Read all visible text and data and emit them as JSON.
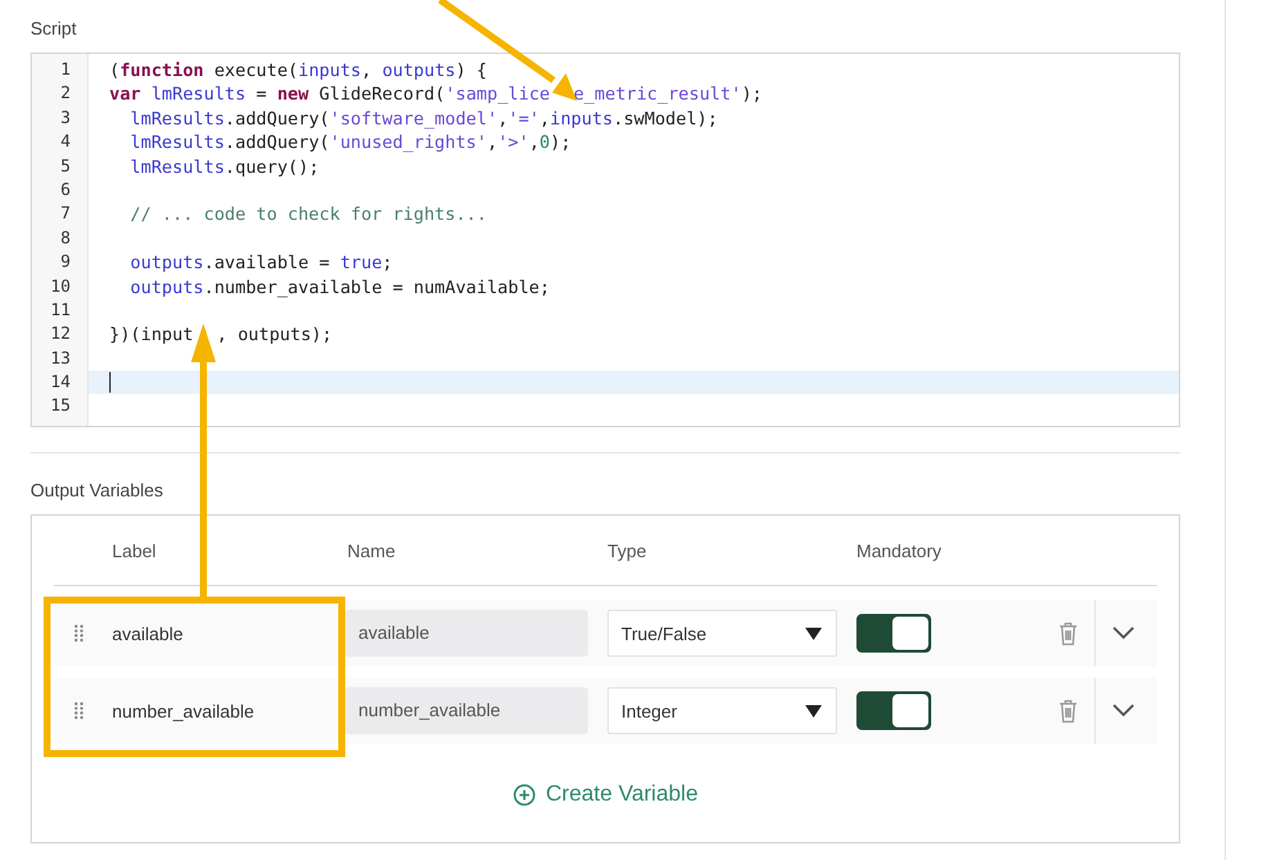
{
  "script": {
    "label": "Script",
    "lines": [
      {
        "number": "1",
        "current": false,
        "tokens": [
          {
            "kind": "plain",
            "text": "("
          },
          {
            "kind": "keyword",
            "text": "function"
          },
          {
            "kind": "plain",
            "text": " execute("
          },
          {
            "kind": "variable",
            "text": "inputs"
          },
          {
            "kind": "plain",
            "text": ", "
          },
          {
            "kind": "variable",
            "text": "outputs"
          },
          {
            "kind": "plain",
            "text": ") {"
          }
        ]
      },
      {
        "number": "2",
        "current": false,
        "tokens": [
          {
            "kind": "keyword",
            "text": "var"
          },
          {
            "kind": "variable",
            "text": " lmResults"
          },
          {
            "kind": "plain",
            "text": " = "
          },
          {
            "kind": "keyword",
            "text": "new"
          },
          {
            "kind": "plain",
            "text": " GlideRecord("
          },
          {
            "kind": "string",
            "text": "'samp_lice"
          },
          {
            "kind": "string",
            "text": "e_metric_result'",
            "after_gap": true
          },
          {
            "kind": "plain",
            "text": ");"
          }
        ]
      },
      {
        "number": "3",
        "current": false,
        "tokens": [
          {
            "kind": "variable",
            "text": "  lmResults"
          },
          {
            "kind": "plain",
            "text": ".addQuery("
          },
          {
            "kind": "string",
            "text": "'software_model'"
          },
          {
            "kind": "plain",
            "text": ","
          },
          {
            "kind": "string",
            "text": "'='"
          },
          {
            "kind": "plain",
            "text": ","
          },
          {
            "kind": "variable",
            "text": "inputs"
          },
          {
            "kind": "plain",
            "text": ".swModel);"
          }
        ]
      },
      {
        "number": "4",
        "current": false,
        "tokens": [
          {
            "kind": "variable",
            "text": "  lmResults"
          },
          {
            "kind": "plain",
            "text": ".addQuery("
          },
          {
            "kind": "string",
            "text": "'unused_rights'"
          },
          {
            "kind": "plain",
            "text": ","
          },
          {
            "kind": "string",
            "text": "'>'"
          },
          {
            "kind": "plain",
            "text": ","
          },
          {
            "kind": "number",
            "text": "0"
          },
          {
            "kind": "plain",
            "text": ");"
          }
        ]
      },
      {
        "number": "5",
        "current": false,
        "tokens": [
          {
            "kind": "variable",
            "text": "  lmResults"
          },
          {
            "kind": "plain",
            "text": ".query();"
          }
        ]
      },
      {
        "number": "6",
        "current": false
      },
      {
        "number": "7",
        "current": false,
        "tokens": [
          {
            "kind": "comment",
            "text": "  // ... code to check for rights..."
          }
        ]
      },
      {
        "number": "8",
        "current": false
      },
      {
        "number": "9",
        "current": false,
        "tokens": [
          {
            "kind": "variable",
            "text": "  outputs"
          },
          {
            "kind": "plain",
            "text": ".available = "
          },
          {
            "kind": "variable",
            "text": "true"
          },
          {
            "kind": "plain",
            "text": ";"
          }
        ]
      },
      {
        "number": "10",
        "current": false,
        "tokens": [
          {
            "kind": "variable",
            "text": "  outputs"
          },
          {
            "kind": "plain",
            "text": ".number_available = numAvailable;"
          }
        ]
      },
      {
        "number": "11",
        "current": false
      },
      {
        "number": "12",
        "current": false,
        "tokens": [
          {
            "kind": "plain",
            "text": "})(input"
          },
          {
            "kind": "plain",
            "text": ", outputs);",
            "after_gap": true
          }
        ]
      },
      {
        "number": "13",
        "current": false
      },
      {
        "number": "14",
        "current": true
      },
      {
        "number": "15",
        "current": false
      }
    ]
  },
  "output_variables": {
    "label": "Output Variables",
    "columns": [
      "Label",
      "Name",
      "Type",
      "Mandatory"
    ],
    "rows": [
      {
        "label": "available",
        "name": "available",
        "type": "True/False",
        "mandatory": true,
        "highlighted": true
      },
      {
        "label": "number_available",
        "name": "number_available",
        "type": "Integer",
        "mandatory": true,
        "highlighted": true
      }
    ],
    "create_button": "Create Variable"
  }
}
